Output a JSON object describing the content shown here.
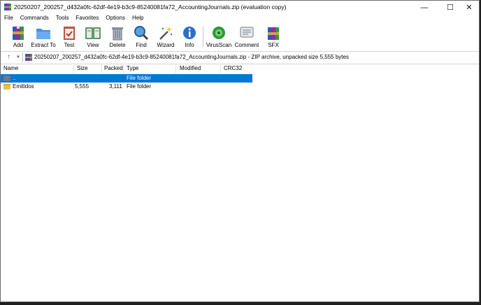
{
  "window": {
    "title": "20250207_200257_d432a0fc-62df-4e19-b3c9-85240081fa72_AccountingJournals.zip (evaluation copy)",
    "min_glyph": "—",
    "max_glyph": "☐",
    "close_glyph": "✕"
  },
  "menu": [
    "File",
    "Commands",
    "Tools",
    "Favorites",
    "Options",
    "Help"
  ],
  "toolbar": {
    "buttons": [
      {
        "label": "Add",
        "icon": "add-archive-icon"
      },
      {
        "label": "Extract To",
        "icon": "extract-folder-icon"
      },
      {
        "label": "Test",
        "icon": "test-clipboard-icon"
      },
      {
        "label": "View",
        "icon": "view-book-icon"
      },
      {
        "label": "Delete",
        "icon": "trash-icon"
      },
      {
        "label": "Find",
        "icon": "magnifier-icon"
      },
      {
        "label": "Wizard",
        "icon": "wand-icon"
      },
      {
        "label": "Info",
        "icon": "info-icon"
      },
      {
        "label": "VirusScan",
        "icon": "virus-scan-icon"
      },
      {
        "label": "Comment",
        "icon": "comment-icon"
      },
      {
        "label": "SFX",
        "icon": "sfx-box-icon"
      }
    ]
  },
  "address": {
    "text": "20250207_200257_d432a0fc-62df-4e19-b3c9-85240081fa72_AccountingJournals.zip - ZIP archive, unpacked size 5,555 bytes"
  },
  "columns": [
    "Name",
    "Size",
    "Packed",
    "Type",
    "Modified",
    "CRC32"
  ],
  "rows": [
    {
      "name": "..",
      "size": "",
      "packed": "",
      "type": "File folder",
      "modified": "",
      "crc": "",
      "selected": true
    },
    {
      "name": "Emitidos",
      "size": "5,555",
      "packed": "3,111",
      "type": "File folder",
      "modified": "",
      "crc": "",
      "selected": false
    }
  ],
  "colors": {
    "selection": "#0078d7",
    "folder": "#e8c14a"
  }
}
